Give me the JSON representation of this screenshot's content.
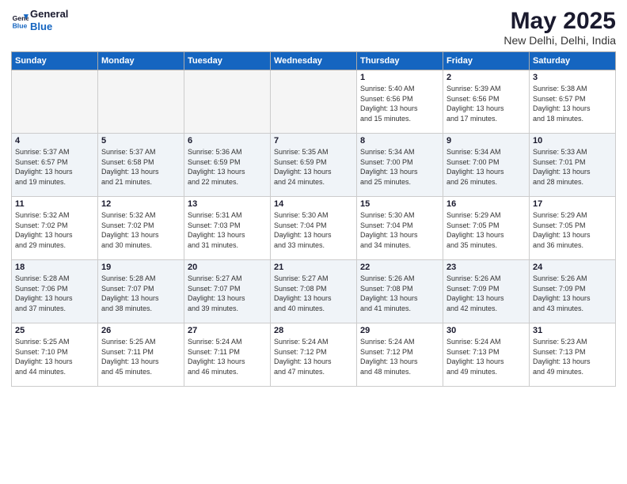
{
  "logo": {
    "line1": "General",
    "line2": "Blue"
  },
  "header": {
    "title": "May 2025",
    "subtitle": "New Delhi, Delhi, India"
  },
  "weekdays": [
    "Sunday",
    "Monday",
    "Tuesday",
    "Wednesday",
    "Thursday",
    "Friday",
    "Saturday"
  ],
  "weeks": [
    [
      {
        "day": "",
        "info": ""
      },
      {
        "day": "",
        "info": ""
      },
      {
        "day": "",
        "info": ""
      },
      {
        "day": "",
        "info": ""
      },
      {
        "day": "1",
        "info": "Sunrise: 5:40 AM\nSunset: 6:56 PM\nDaylight: 13 hours\nand 15 minutes."
      },
      {
        "day": "2",
        "info": "Sunrise: 5:39 AM\nSunset: 6:56 PM\nDaylight: 13 hours\nand 17 minutes."
      },
      {
        "day": "3",
        "info": "Sunrise: 5:38 AM\nSunset: 6:57 PM\nDaylight: 13 hours\nand 18 minutes."
      }
    ],
    [
      {
        "day": "4",
        "info": "Sunrise: 5:37 AM\nSunset: 6:57 PM\nDaylight: 13 hours\nand 19 minutes."
      },
      {
        "day": "5",
        "info": "Sunrise: 5:37 AM\nSunset: 6:58 PM\nDaylight: 13 hours\nand 21 minutes."
      },
      {
        "day": "6",
        "info": "Sunrise: 5:36 AM\nSunset: 6:59 PM\nDaylight: 13 hours\nand 22 minutes."
      },
      {
        "day": "7",
        "info": "Sunrise: 5:35 AM\nSunset: 6:59 PM\nDaylight: 13 hours\nand 24 minutes."
      },
      {
        "day": "8",
        "info": "Sunrise: 5:34 AM\nSunset: 7:00 PM\nDaylight: 13 hours\nand 25 minutes."
      },
      {
        "day": "9",
        "info": "Sunrise: 5:34 AM\nSunset: 7:00 PM\nDaylight: 13 hours\nand 26 minutes."
      },
      {
        "day": "10",
        "info": "Sunrise: 5:33 AM\nSunset: 7:01 PM\nDaylight: 13 hours\nand 28 minutes."
      }
    ],
    [
      {
        "day": "11",
        "info": "Sunrise: 5:32 AM\nSunset: 7:02 PM\nDaylight: 13 hours\nand 29 minutes."
      },
      {
        "day": "12",
        "info": "Sunrise: 5:32 AM\nSunset: 7:02 PM\nDaylight: 13 hours\nand 30 minutes."
      },
      {
        "day": "13",
        "info": "Sunrise: 5:31 AM\nSunset: 7:03 PM\nDaylight: 13 hours\nand 31 minutes."
      },
      {
        "day": "14",
        "info": "Sunrise: 5:30 AM\nSunset: 7:04 PM\nDaylight: 13 hours\nand 33 minutes."
      },
      {
        "day": "15",
        "info": "Sunrise: 5:30 AM\nSunset: 7:04 PM\nDaylight: 13 hours\nand 34 minutes."
      },
      {
        "day": "16",
        "info": "Sunrise: 5:29 AM\nSunset: 7:05 PM\nDaylight: 13 hours\nand 35 minutes."
      },
      {
        "day": "17",
        "info": "Sunrise: 5:29 AM\nSunset: 7:05 PM\nDaylight: 13 hours\nand 36 minutes."
      }
    ],
    [
      {
        "day": "18",
        "info": "Sunrise: 5:28 AM\nSunset: 7:06 PM\nDaylight: 13 hours\nand 37 minutes."
      },
      {
        "day": "19",
        "info": "Sunrise: 5:28 AM\nSunset: 7:07 PM\nDaylight: 13 hours\nand 38 minutes."
      },
      {
        "day": "20",
        "info": "Sunrise: 5:27 AM\nSunset: 7:07 PM\nDaylight: 13 hours\nand 39 minutes."
      },
      {
        "day": "21",
        "info": "Sunrise: 5:27 AM\nSunset: 7:08 PM\nDaylight: 13 hours\nand 40 minutes."
      },
      {
        "day": "22",
        "info": "Sunrise: 5:26 AM\nSunset: 7:08 PM\nDaylight: 13 hours\nand 41 minutes."
      },
      {
        "day": "23",
        "info": "Sunrise: 5:26 AM\nSunset: 7:09 PM\nDaylight: 13 hours\nand 42 minutes."
      },
      {
        "day": "24",
        "info": "Sunrise: 5:26 AM\nSunset: 7:09 PM\nDaylight: 13 hours\nand 43 minutes."
      }
    ],
    [
      {
        "day": "25",
        "info": "Sunrise: 5:25 AM\nSunset: 7:10 PM\nDaylight: 13 hours\nand 44 minutes."
      },
      {
        "day": "26",
        "info": "Sunrise: 5:25 AM\nSunset: 7:11 PM\nDaylight: 13 hours\nand 45 minutes."
      },
      {
        "day": "27",
        "info": "Sunrise: 5:24 AM\nSunset: 7:11 PM\nDaylight: 13 hours\nand 46 minutes."
      },
      {
        "day": "28",
        "info": "Sunrise: 5:24 AM\nSunset: 7:12 PM\nDaylight: 13 hours\nand 47 minutes."
      },
      {
        "day": "29",
        "info": "Sunrise: 5:24 AM\nSunset: 7:12 PM\nDaylight: 13 hours\nand 48 minutes."
      },
      {
        "day": "30",
        "info": "Sunrise: 5:24 AM\nSunset: 7:13 PM\nDaylight: 13 hours\nand 49 minutes."
      },
      {
        "day": "31",
        "info": "Sunrise: 5:23 AM\nSunset: 7:13 PM\nDaylight: 13 hours\nand 49 minutes."
      }
    ]
  ]
}
